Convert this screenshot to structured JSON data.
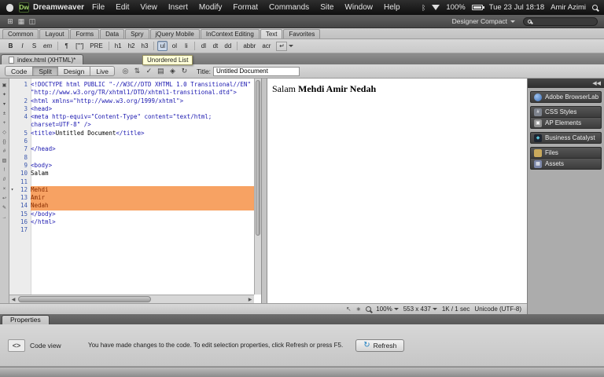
{
  "menubar": {
    "logo": "Dw",
    "app_name": "Dreamweaver",
    "items": [
      "File",
      "Edit",
      "View",
      "Insert",
      "Modify",
      "Format",
      "Commands",
      "Site",
      "Window",
      "Help"
    ],
    "status_right": {
      "battery_pct": "100%",
      "clock": "Tue 23 Jul 18:18",
      "user": "Amir Azimi"
    }
  },
  "app_toolbar": {
    "workspace": "Designer Compact"
  },
  "insert_bar": {
    "tabs": [
      "Common",
      "Layout",
      "Forms",
      "Data",
      "Spry",
      "jQuery Mobile",
      "InContext Editing",
      "Text",
      "Favorites"
    ],
    "active_tab": "Text",
    "button_groups": [
      [
        "B",
        "I",
        "S",
        "em"
      ],
      [
        "¶",
        "[\"\"]",
        "PRE"
      ],
      [
        "h1",
        "h2",
        "h3"
      ],
      [
        "ul",
        "ol",
        "li"
      ],
      [
        "dl",
        "dt",
        "dd"
      ],
      [
        "abbr",
        "acr"
      ]
    ],
    "active_button": "ul",
    "tooltip": "Unordered List"
  },
  "document": {
    "tab_label": "index.html (XHTML)*",
    "views": [
      "Code",
      "Split",
      "Design",
      "Live"
    ],
    "active_view": "Split",
    "toolbar_icons": [
      "preview-globe-icon",
      "file-management-icon",
      "w3c-validation-icon",
      "check-browser-compatibility-icon",
      "visual-aids-icon",
      "refresh-icon"
    ],
    "title_label": "Title:",
    "title_value": "Untitled Document"
  },
  "coding_toolbar_icons": [
    "open-documents-icon",
    "show-code-navigator-icon",
    "collapse-full-tag-icon",
    "collapse-selection-icon",
    "expand-all-icon",
    "select-parent-tag-icon",
    "balance-braces-icon",
    "line-numbers-icon",
    "highlight-invalid-code-icon",
    "syntax-error-alerts-icon",
    "apply-comment-icon",
    "remove-comment-icon",
    "wrap-tag-icon",
    "recent-snippets-icon",
    "indent-code-icon"
  ],
  "code_view": {
    "lines": [
      {
        "num": "1",
        "text": "<!DOCTYPE html PUBLIC \"-//W3C//DTD XHTML 1.0 Transitional//EN\""
      },
      {
        "num": "",
        "text": "\"http://www.w3.org/TR/xhtml1/DTD/xhtml1-transitional.dtd\">",
        "cont": true
      },
      {
        "num": "2",
        "text": "<html xmlns=\"http://www.w3.org/1999/xhtml\">"
      },
      {
        "num": "3",
        "text": "<head>"
      },
      {
        "num": "4",
        "text": "<meta http-equiv=\"Content-Type\" content=\"text/html;"
      },
      {
        "num": "",
        "text": "charset=UTF-8\" />",
        "cont": true
      },
      {
        "num": "5",
        "text": "<title>Untitled Document</title>"
      },
      {
        "num": "6",
        "text": ""
      },
      {
        "num": "7",
        "text": "</head>"
      },
      {
        "num": "8",
        "text": ""
      },
      {
        "num": "9",
        "text": "<body>"
      },
      {
        "num": "10",
        "text": "Salam"
      },
      {
        "num": "11",
        "text": ""
      },
      {
        "num": "12",
        "text": "Mehdi",
        "hl": true,
        "fold": true
      },
      {
        "num": "13",
        "text": "Amir",
        "hl": true
      },
      {
        "num": "14",
        "text": "Nedah",
        "hl": true
      },
      {
        "num": "15",
        "text": "</body>"
      },
      {
        "num": "16",
        "text": "</html>"
      },
      {
        "num": "17",
        "text": ""
      }
    ]
  },
  "design_view": {
    "text_plain": "Salam ",
    "text_bold": "Mehdi Amir Nedah"
  },
  "sidebar": {
    "groups": [
      {
        "panels": [
          {
            "label": "Adobe BrowserLab",
            "icon": "browserlab-icon"
          }
        ]
      },
      {
        "panels": [
          {
            "label": "CSS Styles",
            "icon": "css-styles-icon"
          },
          {
            "label": "AP Elements",
            "icon": "ap-elements-icon"
          }
        ]
      },
      {
        "panels": [
          {
            "label": "Business Catalyst",
            "icon": "business-catalyst-icon"
          }
        ]
      },
      {
        "panels": [
          {
            "label": "Files",
            "icon": "files-icon"
          },
          {
            "label": "Assets",
            "icon": "assets-icon"
          }
        ]
      }
    ]
  },
  "status_bar": {
    "zoom": "100%",
    "dimensions": "553 x 437",
    "size_time": "1K / 1 sec",
    "encoding": "Unicode (UTF-8)"
  },
  "properties": {
    "tab_label": "Properties",
    "mode_label": "Code view",
    "message": "You have made changes to the code. To edit selection properties, click Refresh or press F5.",
    "refresh_label": "Refresh"
  }
}
